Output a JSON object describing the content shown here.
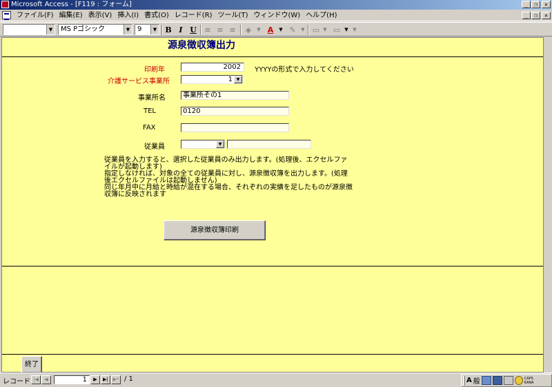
{
  "window": {
    "title": "Microsoft Access - [F119 : フォーム]",
    "minimize": "_",
    "restore": "❐",
    "close": "✕"
  },
  "menu": {
    "items": [
      "ファイル(F)",
      "編集(E)",
      "表示(V)",
      "挿入(I)",
      "書式(O)",
      "レコード(R)",
      "ツール(T)",
      "ウィンドウ(W)",
      "ヘルプ(H)"
    ]
  },
  "toolbar": {
    "object_combo": "",
    "font_name": "MS Pゴシック",
    "font_size": "9",
    "bold": "B",
    "italic": "I",
    "underline": "U"
  },
  "form": {
    "title": "源泉徴収簿出力",
    "print_year_label": "印刷年",
    "print_year_value": "2002",
    "print_year_hint": "YYYYの形式で入力してください",
    "office_label": "介護サービス事業所",
    "office_value": "1",
    "office_name_label": "事業所名",
    "office_name_value": "事業所その1",
    "tel_label": "TEL",
    "tel_value": "0120",
    "fax_label": "FAX",
    "fax_value": "",
    "employee_label": "従業員",
    "employee_value": "",
    "employee_name_value": "",
    "notes": [
      "従業員を入力すると、選択した従業員のみ出力します。(処理後、エクセルファイルが起動します)",
      "指定しなければ、対象の全ての従業員に対し、源泉徴収簿を出力します。(処理後エクセルファイルは起動しません)",
      "同じ年月中に月給と時給が混在する場合、それぞれの実績を足したものが源泉徴収簿に反映されます"
    ],
    "print_button": "源泉徴収簿印刷",
    "exit_button": "終了"
  },
  "record_nav": {
    "label": "レコード:",
    "current": "1",
    "total": "/ 1"
  },
  "ime": {
    "mode": "般",
    "caps": "CAPS",
    "kana": "KANA"
  }
}
